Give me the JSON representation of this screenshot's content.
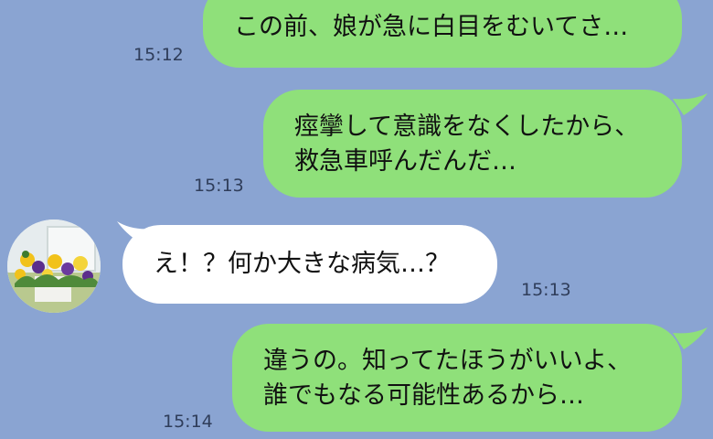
{
  "messages": [
    {
      "side": "out",
      "lines": [
        "この前、娘が急に白目をむいてさ…"
      ],
      "time": "15:12"
    },
    {
      "side": "out",
      "lines": [
        "痙攣して意識をなくしたから、",
        "救急車呼んだんだ…"
      ],
      "time": "15:13"
    },
    {
      "side": "in",
      "lines": [
        "え！？何か大きな病気…？"
      ],
      "time": "15:13"
    },
    {
      "side": "out",
      "lines": [
        "違うの。知ってたほうがいいよ、",
        "誰でもなる可能性あるから…"
      ],
      "time": "15:14"
    }
  ],
  "colors": {
    "background": "#8aa4d2",
    "outgoing_bubble": "#8fe07a",
    "incoming_bubble": "#ffffff"
  },
  "contact": {
    "avatar_icon": "flower-pot-avatar"
  }
}
